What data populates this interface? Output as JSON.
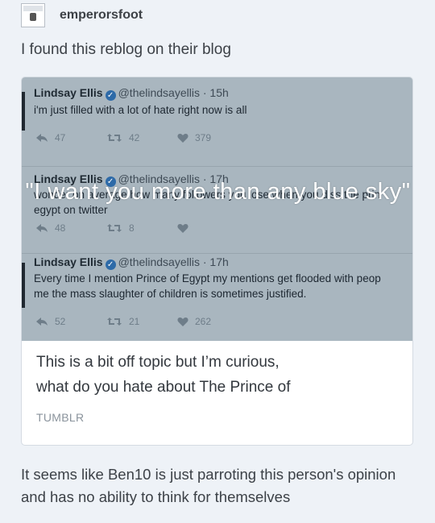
{
  "post": {
    "username": "emperorsfoot",
    "intro_text": "I found this reblog on their blog",
    "comment_text": "It seems like Ben10 is just parroting this person's opinion and has no ability to think for themselves"
  },
  "tweets": [
    {
      "name": "Lindsay Ellis",
      "handle": "@thelindsayellis",
      "time": "· 15h",
      "text": "i'm just filled with a lot of hate right now is all",
      "replies": "47",
      "retweets": "42",
      "likes": "379"
    },
    {
      "name": "Lindsay Ellis",
      "handle": "@thelindsayellis",
      "time": "· 17h",
      "text_line1": "wonder on average how many followers you lose when you diss the prin",
      "text_line2": "egypt on twitter",
      "replies": "48",
      "retweets": "8",
      "likes": ""
    },
    {
      "name": "Lindsay Ellis",
      "handle": "@thelindsayellis",
      "time": "· 17h",
      "text_line1": "Every time I mention Prince of Egypt my mentions get flooded with peop",
      "text_line2": "me the mass slaughter of children is sometimes justified.",
      "replies": "52",
      "retweets": "21",
      "likes": "262"
    }
  ],
  "overlay_text": "\"I want you more than any blue sky\"",
  "preview": {
    "text": "This is a bit off topic but I’m curious,\nwhat do you hate about The Prince of",
    "source": "TUMBLR"
  },
  "icons": [
    "reply-icon",
    "retweet-icon",
    "heart-icon",
    "verified-icon"
  ]
}
